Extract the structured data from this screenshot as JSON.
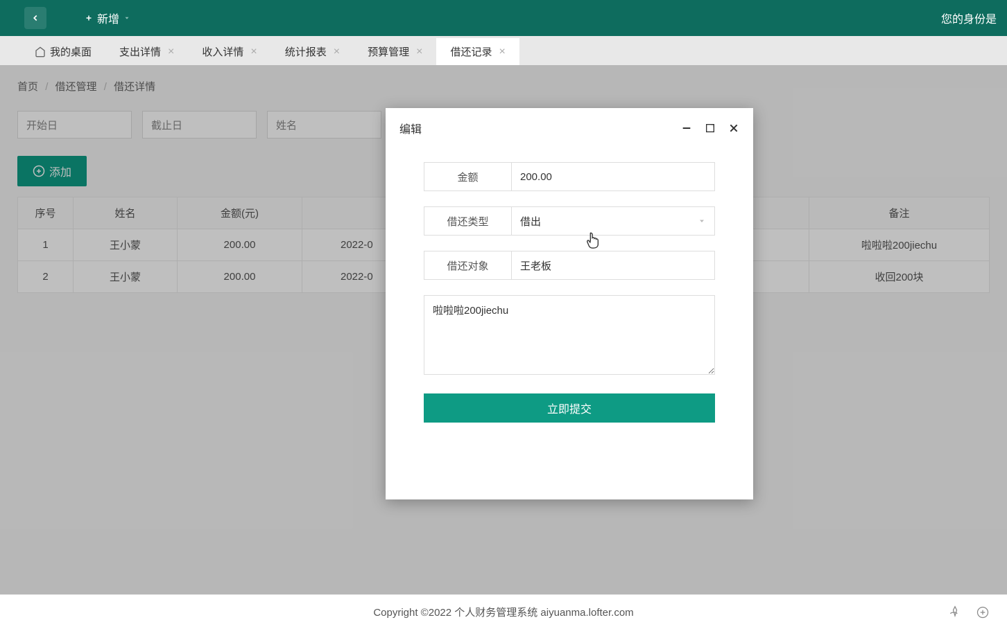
{
  "header": {
    "add_new": "新增",
    "identity": "您的身份是"
  },
  "tabs": {
    "home": "我的桌面",
    "items": [
      "支出详情",
      "收入详情",
      "统计报表",
      "预算管理",
      "借还记录"
    ],
    "active_index": 4
  },
  "breadcrumb": {
    "home": "首页",
    "section": "借还管理",
    "page": "借还详情"
  },
  "filters": {
    "start_date": "开始日",
    "end_date": "截止日",
    "name": "姓名"
  },
  "add_button": "添加",
  "table": {
    "headers": [
      "序号",
      "姓名",
      "金额(元)",
      "",
      "备注"
    ],
    "rows": [
      {
        "seq": "1",
        "name": "王小蒙",
        "amount": "200.00",
        "date": "2022-0",
        "remark": "啦啦啦200jiechu"
      },
      {
        "seq": "2",
        "name": "王小蒙",
        "amount": "200.00",
        "date": "2022-0",
        "remark": "收回200块"
      }
    ]
  },
  "modal": {
    "title": "编辑",
    "fields": {
      "amount_label": "金额",
      "amount_value": "200.00",
      "type_label": "借还类型",
      "type_value": "借出",
      "target_label": "借还对象",
      "target_value": "王老板",
      "note_value": "啦啦啦200jiechu"
    },
    "submit": "立即提交"
  },
  "footer": {
    "copyright": "Copyright ©2022 个人财务管理系统 aiyuanma.lofter.com"
  }
}
